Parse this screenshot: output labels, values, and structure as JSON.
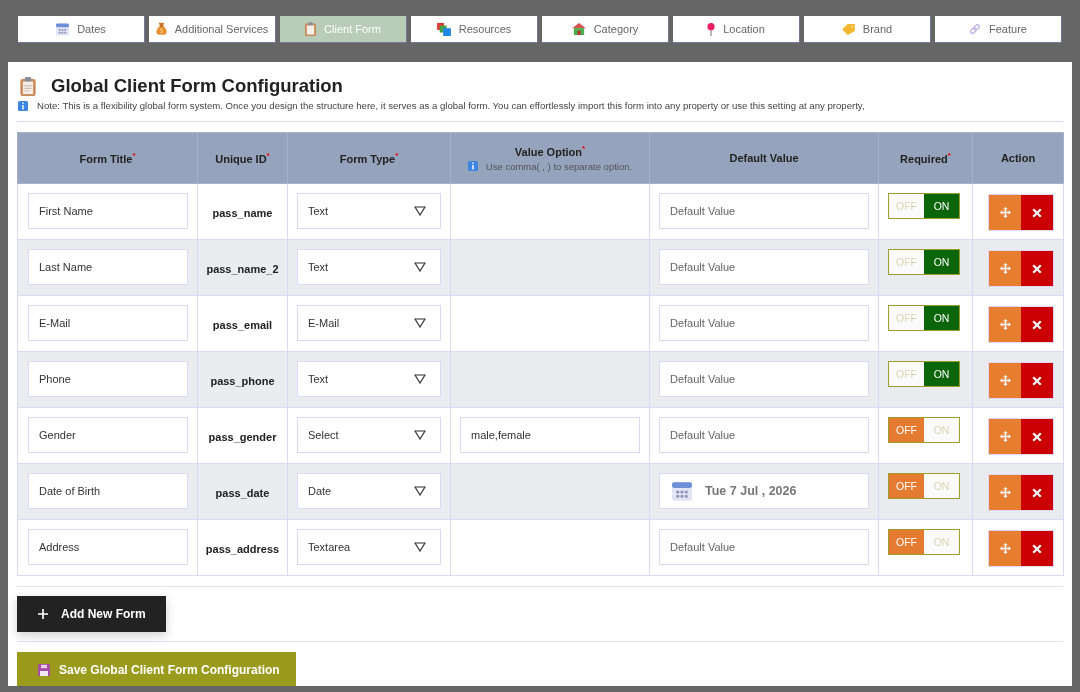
{
  "tabs": [
    {
      "label": "Dates",
      "selected": false
    },
    {
      "label": "Additional Services",
      "selected": false
    },
    {
      "label": "Client Form",
      "selected": true
    },
    {
      "label": "Resources",
      "selected": false
    },
    {
      "label": "Category",
      "selected": false
    },
    {
      "label": "Location",
      "selected": false
    },
    {
      "label": "Brand",
      "selected": false
    },
    {
      "label": "Feature",
      "selected": false
    }
  ],
  "header": {
    "title": "Global Client Form Configuration",
    "note": "Note: This is a flexibility global form system. Once you design the structure here, it serves as a global form. You can effortlessly import this form into any property or use this setting at any property,"
  },
  "table": {
    "columns": [
      {
        "label": "Form Title$^{*}$"
      },
      {
        "label": "Unique ID$^{*}$"
      },
      {
        "label": "Form Type$^{*}$"
      },
      {
        "label": "Value Option$^{*}$",
        "hint": "Use comma( , ) to separate option."
      },
      {
        "label": "Default Value"
      },
      {
        "label": "Required$^{*}$"
      },
      {
        "label": "Action"
      }
    ],
    "rows": [
      {
        "form_title": "First Name",
        "unique_id": "pass_name",
        "form_type": "Text",
        "default_value": {
          "kind": "text",
          "placeholder": "Default Value"
        },
        "required": {
          "off_label": "OFF",
          "on_label": "ON",
          "on": true
        }
      },
      {
        "form_title": "Last Name",
        "unique_id": "pass_name_2",
        "form_type": "Text",
        "default_value": {
          "kind": "text",
          "placeholder": "Default Value"
        },
        "required": {
          "off_label": "OFF",
          "on_label": "ON",
          "on": true
        }
      },
      {
        "form_title": "E-Mail",
        "unique_id": "pass_email",
        "form_type": "E-Mail",
        "default_value": {
          "kind": "text",
          "placeholder": "Default Value"
        },
        "required": {
          "off_label": "OFF",
          "on_label": "ON",
          "on": true
        }
      },
      {
        "form_title": "Phone",
        "unique_id": "pass_phone",
        "form_type": "Text",
        "default_value": {
          "kind": "text",
          "placeholder": "Default Value"
        },
        "required": {
          "off_label": "OFF",
          "on_label": "ON",
          "on": true
        }
      },
      {
        "form_title": "Gender",
        "unique_id": "pass_gender",
        "form_type": "Select",
        "value_option": "male,female",
        "default_value": {
          "kind": "text",
          "placeholder": "Default Value"
        },
        "required": {
          "off_label": "OFF",
          "on_label": "ON",
          "on": false
        }
      },
      {
        "form_title": "Date of Birth",
        "unique_id": "pass_date",
        "form_type": "Date",
        "default_value": {
          "kind": "date",
          "value": "Tue 7 Jul , 2026"
        },
        "required": {
          "off_label": "OFF",
          "on_label": "ON",
          "on": false
        }
      },
      {
        "form_title": "Address",
        "unique_id": "pass_address",
        "form_type": "Textarea",
        "default_value": {
          "kind": "text",
          "placeholder": "Default Value"
        },
        "required": {
          "off_label": "OFF",
          "on_label": "ON",
          "on": false
        }
      }
    ]
  },
  "buttons": {
    "add": "Add New Form",
    "save": "Save Global Client Form Configuration"
  }
}
